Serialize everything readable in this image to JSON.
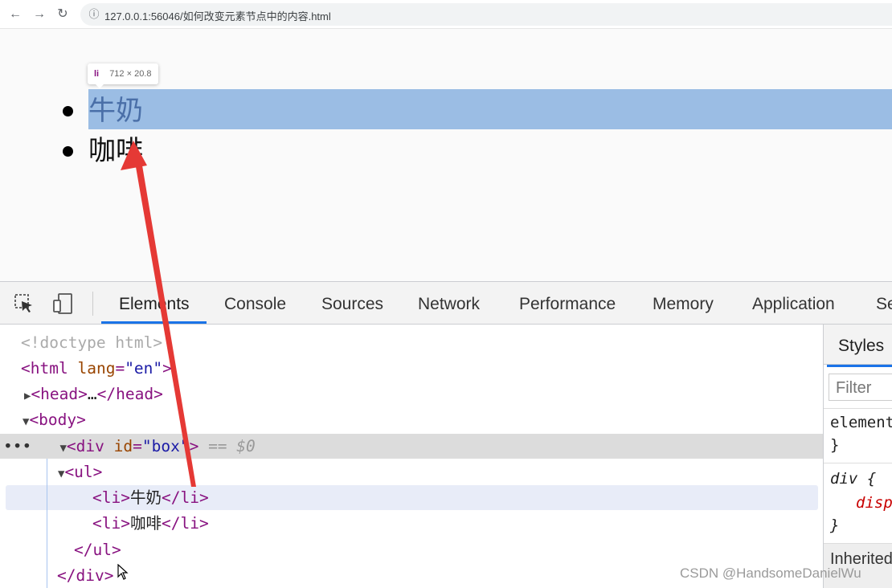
{
  "browser": {
    "url": "127.0.0.1:56046/如何改变元素节点中的内容.html",
    "back_icon": "arrow-left-icon",
    "forward_icon": "arrow-right-icon",
    "reload_icon": "reload-icon",
    "site_info_icon": "info-icon"
  },
  "page": {
    "tooltip": {
      "tag": "li",
      "dims": "712 × 20.8"
    },
    "list_items": [
      "牛奶",
      "咖啡"
    ],
    "highlight_color": "#9bbde4"
  },
  "devtools": {
    "tabs": [
      "Elements",
      "Console",
      "Sources",
      "Network",
      "Performance",
      "Memory",
      "Application",
      "Se"
    ],
    "active_tab": "Elements",
    "dom": {
      "doctype": "<!doctype html>",
      "html_tag": "html",
      "lang_attr": "lang",
      "lang_val": "\"en\"",
      "head_open": "<head>",
      "head_ellipsis": "…",
      "head_close": "</head>",
      "body_open": "<body>",
      "div_tag": "div",
      "div_attr": "id",
      "div_val": "\"box\"",
      "div_marker": "== $0",
      "ul_open": "<ul>",
      "li_open": "<li>",
      "li1_text": "牛奶",
      "li2_text": "咖啡",
      "li_close": "</li>",
      "ul_close": "</ul>",
      "div_close": "</div>",
      "row_dots": "•••"
    },
    "styles": {
      "tab": "Styles",
      "filter_placeholder": "Filter",
      "element_style": "element.style {",
      "close_brace": "}",
      "div_rule": "div {",
      "div_prop": "display",
      "inherited": "Inherited from"
    }
  },
  "watermark": "CSDN @HandsomeDanielWu",
  "colors": {
    "accent": "#1a73e8",
    "arrow": "#e53935",
    "tag": "#881280",
    "attr": "#994500",
    "value": "#1a1aa6"
  }
}
